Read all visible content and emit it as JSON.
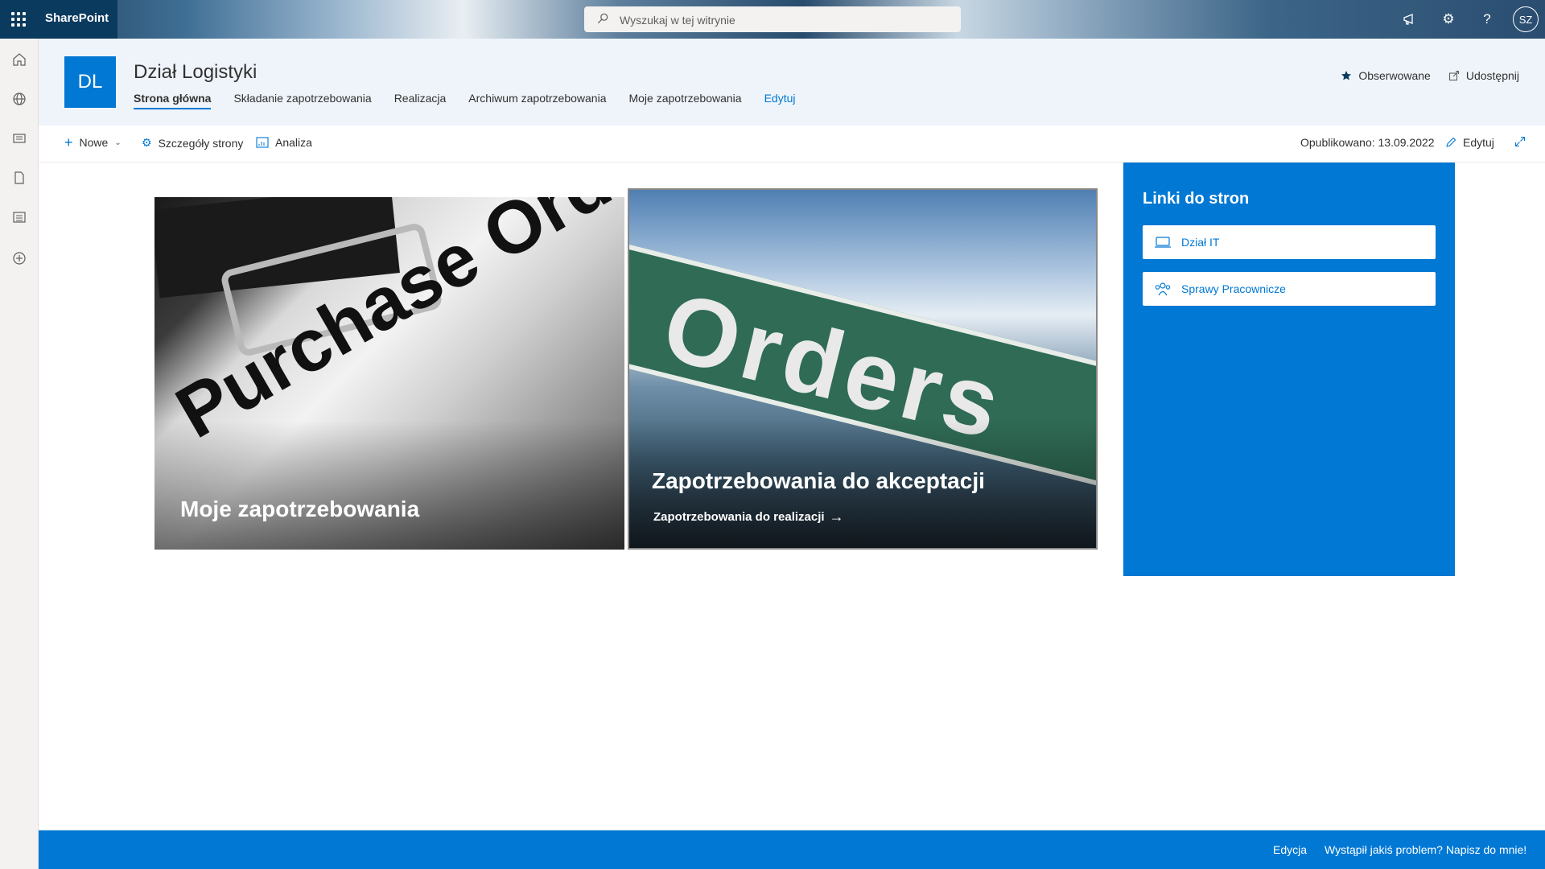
{
  "suitebar": {
    "app_name": "SharePoint",
    "search_placeholder": "Wyszukaj w tej witrynie",
    "user_initials": "SZ"
  },
  "site": {
    "logo_initials": "DL",
    "title": "Dział Logistyki",
    "nav": [
      {
        "label": "Strona główna",
        "active": true
      },
      {
        "label": "Składanie zapotrzebowania"
      },
      {
        "label": "Realizacja"
      },
      {
        "label": "Archiwum zapotrzebowania"
      },
      {
        "label": "Moje zapotrzebowania"
      },
      {
        "label": "Edytuj"
      }
    ],
    "follow_label": "Obserwowane",
    "share_label": "Udostępnij"
  },
  "commandbar": {
    "new_label": "Nowe",
    "page_details_label": "Szczegóły strony",
    "analytics_label": "Analiza",
    "published": "Opublikowano: 13.09.2022",
    "edit_label": "Edytuj"
  },
  "hero": {
    "left_image_text": "Purchase Order",
    "left_title": "Moje zapotrzebowania",
    "right_image_text": "Orders",
    "right_title": "Zapotrzebowania do akceptacji",
    "right_link": "Zapotrzebowania do realizacji"
  },
  "quick_links": {
    "title": "Linki do stron",
    "items": [
      {
        "label": "Dział IT",
        "icon": "laptop-icon"
      },
      {
        "label": "Sprawy Pracownicze",
        "icon": "people-icon"
      }
    ]
  },
  "footer": {
    "edit_label": "Edycja",
    "feedback_label": "Wystąpił jakiś problem? Napisz do mnie!"
  },
  "colors": {
    "accent": "#0078d4",
    "suitebar": "#0a3a5e"
  }
}
